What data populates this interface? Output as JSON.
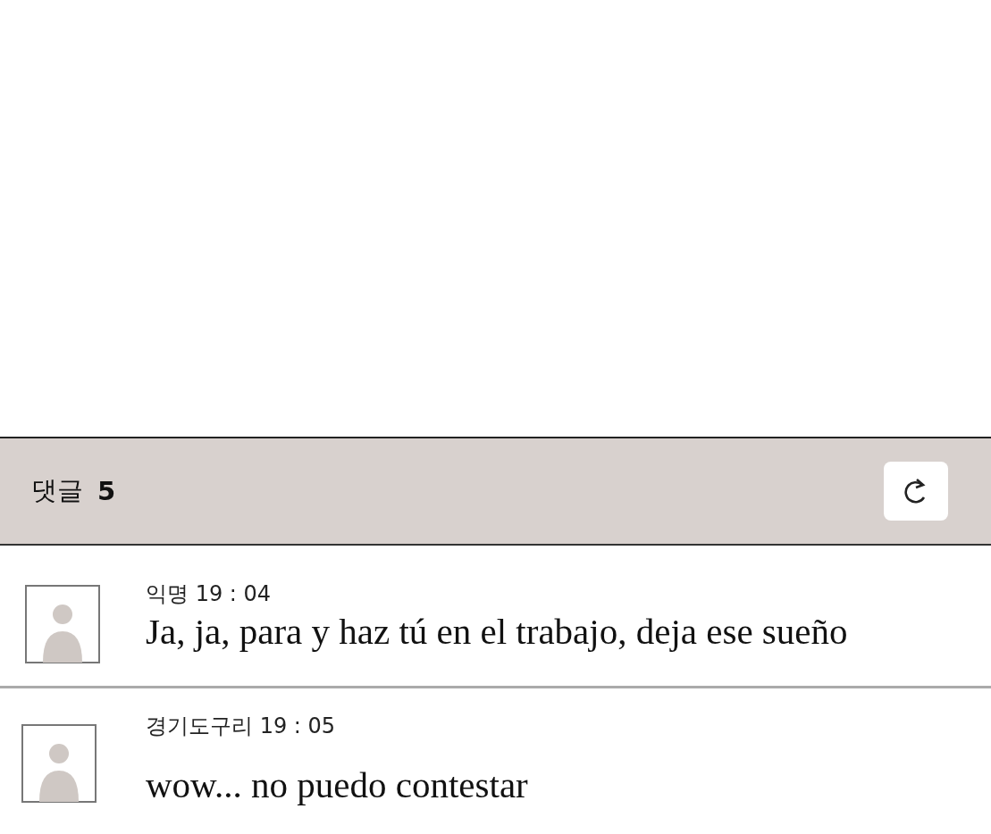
{
  "header": {
    "label": "댓글",
    "count": "5"
  },
  "comments": [
    {
      "author": "익명",
      "time": "19 : 04",
      "text": "Ja, ja, para y haz tú en el trabajo, deja ese sueño"
    },
    {
      "author": "경기도구리",
      "time": "19 : 05",
      "text": "wow... no puedo contestar"
    }
  ]
}
